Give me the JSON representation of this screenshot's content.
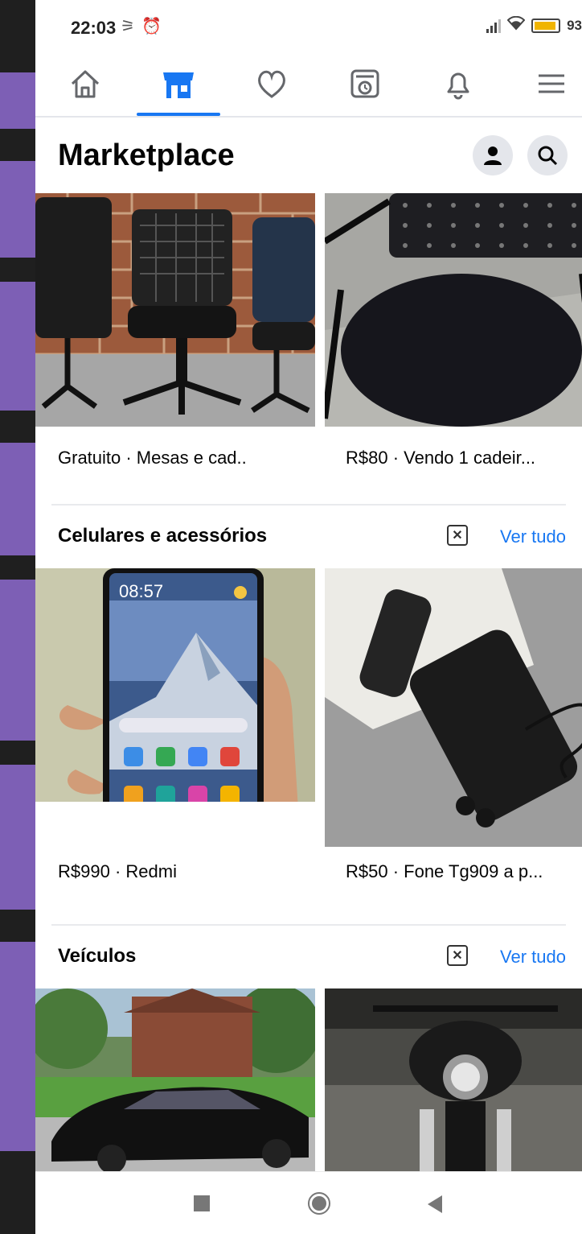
{
  "status_bar": {
    "time": "22:03",
    "battery": "93",
    "battery_level": 0.93
  },
  "nav": {
    "items": [
      "home-icon",
      "marketplace-icon",
      "dating-icon",
      "memories-icon",
      "notifications-icon",
      "menu-icon"
    ],
    "active": "marketplace-icon",
    "accent_color": "#1877f2"
  },
  "header": {
    "title": "Marketplace"
  },
  "listings_top": [
    {
      "caption": "Gratuito · Mesas e cad..",
      "image": "office chairs"
    },
    {
      "caption": "R$80 · Vendo 1 cadeir...",
      "image": "office chair"
    }
  ],
  "sections": [
    {
      "title": "Celulares e acessórios",
      "link": "Ver tudo",
      "items": [
        {
          "caption": "R$990 · Redmi",
          "image": "smartphone",
          "screen_time": "08:57"
        },
        {
          "caption": "R$50 · Fone Tg909 a p...",
          "image": "wireless earbuds"
        }
      ]
    },
    {
      "title": "Veículos",
      "link": "Ver tudo",
      "items": [
        {
          "caption": "",
          "image": "car"
        },
        {
          "caption": "",
          "image": "motorcycle"
        }
      ]
    }
  ]
}
